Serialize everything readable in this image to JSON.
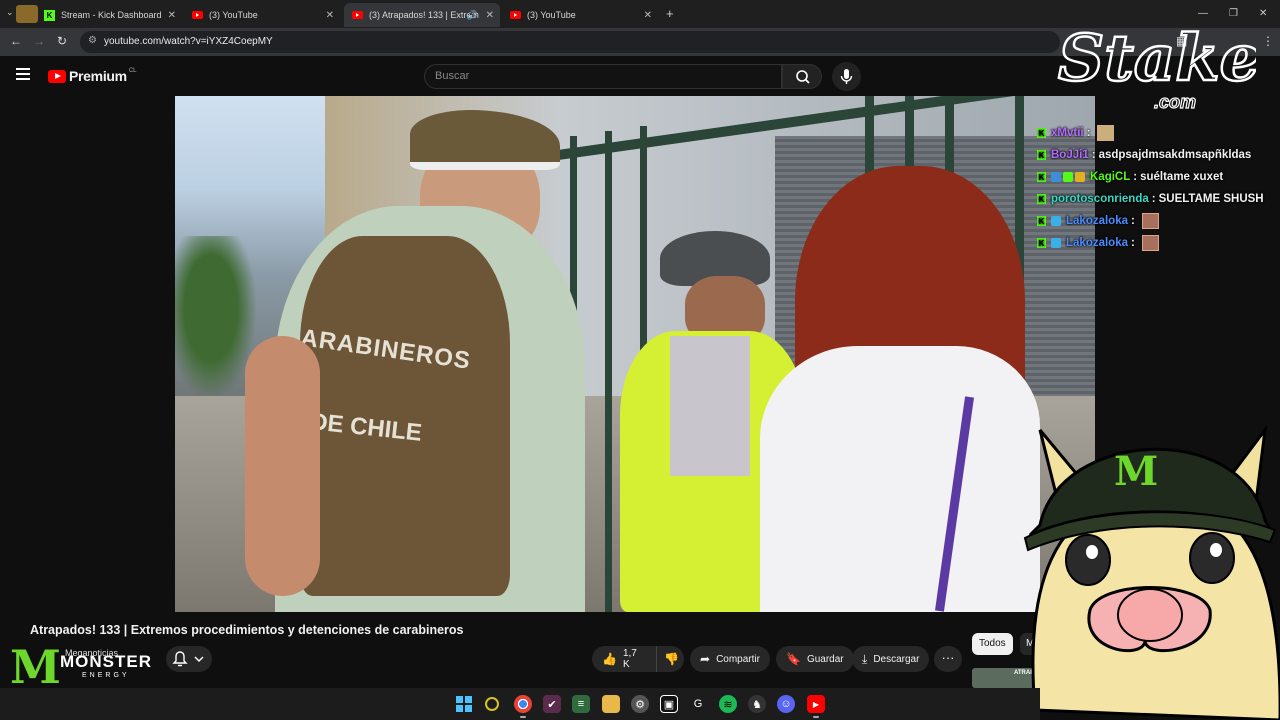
{
  "browser": {
    "tabs": [
      {
        "title": "Stream - Kick Dashboard",
        "favicon": "kick-icon",
        "active": false
      },
      {
        "title": "(3) YouTube",
        "favicon": "youtube-icon",
        "active": false
      },
      {
        "title": "(3) Atrapados! 133 | Extrem",
        "favicon": "youtube-icon",
        "active": true,
        "audio": true
      },
      {
        "title": "(3) YouTube",
        "favicon": "youtube-icon",
        "active": false
      }
    ],
    "new_tab": "+",
    "url": "youtube.com/watch?v=iYXZ4CoepMY"
  },
  "youtube": {
    "logo_word": "Premium",
    "region": "CL",
    "search_placeholder": "Buscar",
    "video": {
      "title": "Atrapados! 133 | Extremos procedimientos y detenciones de carabineros",
      "vest_text_line1": "ARABINEROS",
      "vest_text_line2": "DE CHILE",
      "likes": "1,7 K",
      "share_label": "Compartir",
      "save_label": "Guardar",
      "download_label": "Descargar",
      "more_label": "···"
    },
    "channel": {
      "name": "Meganoticias"
    },
    "chips": [
      "Todos",
      "M"
    ],
    "recommended_thumb_text": "ATRAPADOS!"
  },
  "overlay": {
    "stake_word": "Stake",
    "stake_tld": ".com",
    "monster_word": "MONSTER",
    "monster_sub": "ENERGY",
    "chat": [
      {
        "user": "xMvtii",
        "color": "#b36bff",
        "message": ""
      },
      {
        "user": "BoJJi1",
        "color": "#b36bff",
        "message": "asdpsajdmsakdmsapñkldas"
      },
      {
        "user": "KagiCL",
        "color": "#53fc18",
        "message": "suéltame xuxet"
      },
      {
        "user": "porotosconrienda",
        "color": "#3ad7c1",
        "message": "SUELTAME SHUSH"
      },
      {
        "user": "Lakozaloka",
        "color": "#4a8cff",
        "message": ""
      },
      {
        "user": "Lakozaloka",
        "color": "#4a8cff",
        "message": ""
      }
    ]
  },
  "colors": {
    "youtube_red": "#ff0000",
    "kick_green": "#53fc18",
    "monster_green": "#6ed72b",
    "background": "#0f0f0f"
  }
}
